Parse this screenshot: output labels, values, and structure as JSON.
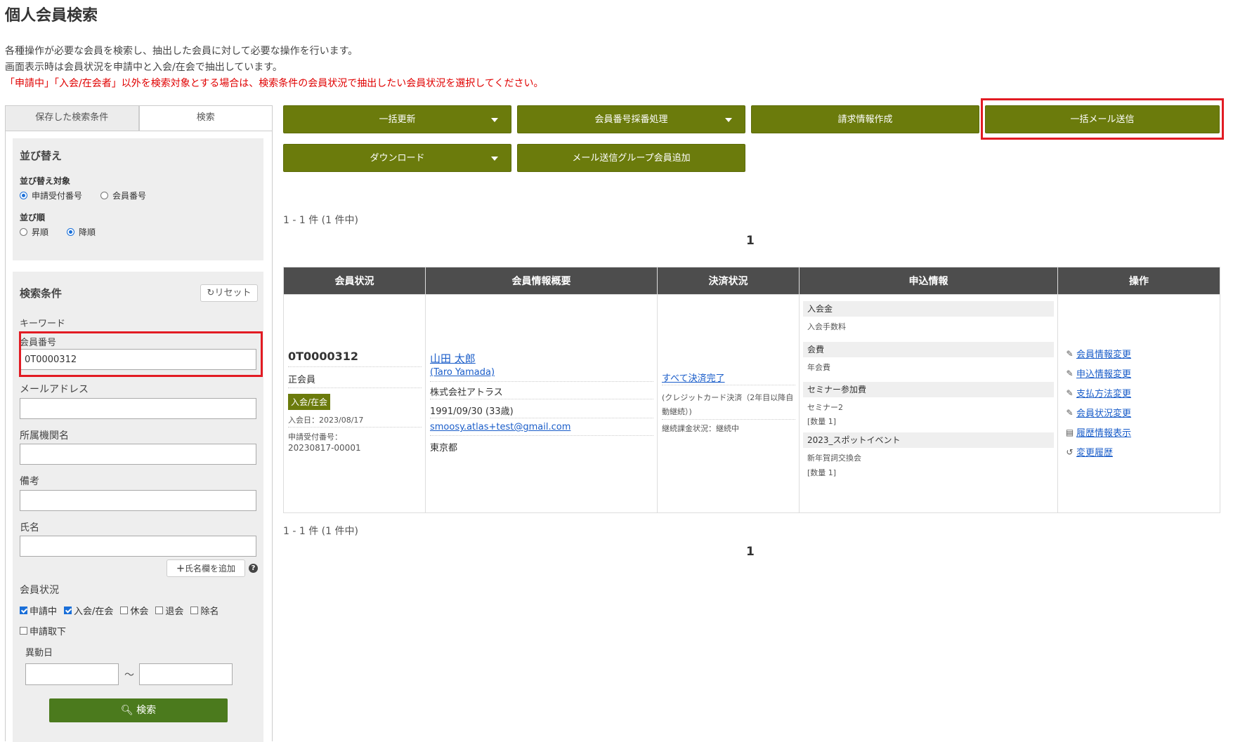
{
  "page": {
    "title": "個人会員検索",
    "desc_line1": "各種操作が必要な会員を検索し、抽出した会員に対して必要な操作を行います。",
    "desc_line2": "画面表示時は会員状況を申請中と入会/在会で抽出しています。",
    "desc_warning": "「申請中」「入会/在会者」以外を検索対象とする場合は、検索条件の会員状況で抽出したい会員状況を選択してください。"
  },
  "tabs": [
    {
      "label": "保存した検索条件",
      "active": false
    },
    {
      "label": "検索",
      "active": true
    }
  ],
  "sort": {
    "title": "並び替え",
    "target_label": "並び替え対象",
    "target_options": [
      {
        "label": "申請受付番号",
        "selected": true
      },
      {
        "label": "会員番号",
        "selected": false
      }
    ],
    "order_label": "並び順",
    "order_options": [
      {
        "label": "昇順",
        "selected": false
      },
      {
        "label": "降順",
        "selected": true
      }
    ]
  },
  "search": {
    "title": "検索条件",
    "reset_label": "リセット",
    "keyword_label": "キーワード",
    "member_no_label": "会員番号",
    "member_no_value": "0T0000312",
    "email_label": "メールアドレス",
    "email_value": "",
    "org_label": "所属機関名",
    "org_value": "",
    "memo_label": "備考",
    "memo_value": "",
    "name_label": "氏名",
    "name_value": "",
    "add_name_label": "氏名欄を追加",
    "status_label": "会員状況",
    "statuses": [
      {
        "label": "申請中",
        "checked": true
      },
      {
        "label": "入会/在会",
        "checked": true
      },
      {
        "label": "休会",
        "checked": false
      },
      {
        "label": "退会",
        "checked": false
      },
      {
        "label": "除名",
        "checked": false
      },
      {
        "label": "申請取下",
        "checked": false
      }
    ],
    "change_date_label": "異動日",
    "date_from": "",
    "date_to": "",
    "tilde": "～",
    "search_button": "検索"
  },
  "actions": {
    "bulk_update": "一括更新",
    "member_no_assign": "会員番号採番処理",
    "invoice_create": "請求情報作成",
    "bulk_mail": "一括メール送信",
    "download": "ダウンロード",
    "mail_group_add": "メール送信グループ会員追加"
  },
  "pagination": {
    "count_text": "1 - 1 件 (1 件中)",
    "page": "1"
  },
  "table": {
    "headers": [
      "会員状況",
      "会員情報概要",
      "決済状況",
      "申込情報",
      "操作"
    ],
    "row": {
      "member_no": "0T0000312",
      "member_type": "正会員",
      "status_badge": "入会/在会",
      "join_date": "入会日：2023/08/17",
      "app_no_label": "申請受付番号：",
      "app_no": "20230817-00001",
      "name": "山田 太郎",
      "name_en": "(Taro Yamada)",
      "company": "株式会社アトラス",
      "birth": "1991/09/30 (33歳)",
      "email": "smoosy.atlas+test@gmail.com",
      "pref": "東京都",
      "payment_status": "すべて決済完了",
      "payment_method_1": "(クレジットカード決済（2年目以降自",
      "payment_method_2": "動継続）)",
      "continuing": "継続課金状況：継続中",
      "applications": [
        {
          "head": "入会金",
          "sub1": "入会手数料",
          "sub2": ""
        },
        {
          "head": "会費",
          "sub1": "年会費",
          "sub2": ""
        },
        {
          "head": "セミナー参加費",
          "sub1": "セミナー2",
          "sub2": "[数量 1]"
        },
        {
          "head": "2023_スポットイベント",
          "sub1": "新年賀詞交換会",
          "sub2": "[数量 1]"
        }
      ],
      "operations": [
        {
          "label": "会員情報変更",
          "icon": "pencil-icon"
        },
        {
          "label": "申込情報変更",
          "icon": "pencil-icon"
        },
        {
          "label": "支払方法変更",
          "icon": "pencil-icon"
        },
        {
          "label": "会員状況変更",
          "icon": "pencil-icon"
        },
        {
          "label": "履歴情報表示",
          "icon": "document-icon"
        },
        {
          "label": "変更履歴",
          "icon": "history-icon"
        }
      ]
    }
  },
  "colors": {
    "accent_olive": "#6b7b0c",
    "search_green": "#4b7a1d",
    "highlight_red": "#e21b23",
    "warning_red": "#e00000",
    "link_blue": "#1a5dc9"
  }
}
